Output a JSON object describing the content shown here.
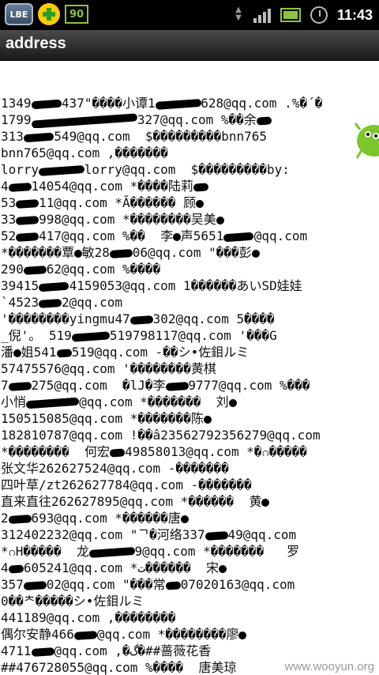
{
  "statusbar": {
    "lbe_label": "LBE",
    "battery_badge": "90",
    "time": "11:43"
  },
  "title": "address",
  "lines": [
    "1349░░░░437\"����小谭1░░░░░░628@qq.com .%�´�",
    "1799░░░░░░░░░░░░░░327@qq.com %��余░░",
    "313░░░░549@qq.com  $���������bnn765",
    "bnn765@qq.com ,�������",
    "lorry░░░░░░lorry@qq.com  $���������by:",
    "4░░░14054@qq.com *����陆莉░░",
    "53░░░11@qq.com *Ă������ 顾░",
    "33░░░998@qq.com *��������吴美░",
    "52░░░417@qq.com %��  李░声5651░░░░@qq.com",
    "*�������覃░敏28░░░06@qq.com \"���彭░",
    "290░░░62@qq.com %����",
    "39415░░░░4159053@qq.com 1������あいSD娃娃",
    "`4523░░░2@qq.com",
    "'��������yingmu47░░░302@qq.com 5����",
    "_倪'。 519░░░░░519798117@qq.com '���G",
    "潘░姐541░░519@qq.com -��シ•佐鉬ルミ",
    "57475576@qq.com '��������黄棋",
    "7░░░275@qq.com  �lJ�李░░░9777@qq.com %���",
    "小悄░░░░░░░@qq.com *�������  刘░",
    "150515085@qq.com *�������陈░",
    "182810787@qq.com !��â2356279235627​9@qq.com",
    "*��������  何宏░░49858013@qq.com *�ဂ�����",
    "张文华262627524@qq.com -�������",
    "四叶草/zt262627784@qq.com -�������",
    "直来直往262627895@qq.com *������  黄░",
    "2░░░693@qq.com *������唐░",
    "312402232@qq.com \"ᄀ�河络337░░░49@qq.com",
    "*ဂH�����  龙░░░░░░9@qq.com *�������   罗",
    "4░░605241@qq.com *ت������  宋░",
    "357░░░02@qq.com \"���常░░07020163@qq.com",
    "0��ᄎ�����シ•佐鉬ルミ",
    "441189@qq.com ,��������",
    "偶尔安静466░░░@qq.com *��������廖░",
    "4711░░░@qq.com ,�گ�##蔷薇花香",
    "##476728055@qq.com %����  唐美琼"
  ],
  "watermark": "www.wooyun.org"
}
